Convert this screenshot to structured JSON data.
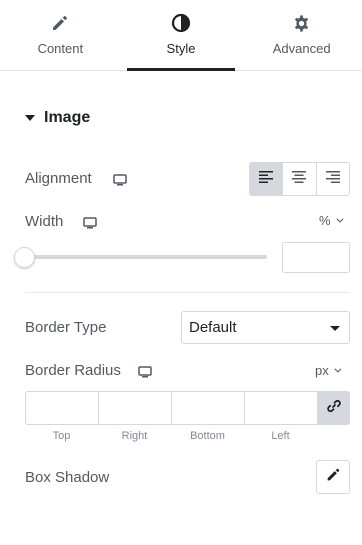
{
  "tabs": [
    {
      "label": "Content",
      "icon": "pencil-icon"
    },
    {
      "label": "Style",
      "icon": "half-circle-icon"
    },
    {
      "label": "Advanced",
      "icon": "gear-icon"
    }
  ],
  "active_tab": "Style",
  "section": {
    "title": "Image",
    "state": "expanded"
  },
  "alignment": {
    "label": "Alignment",
    "options": [
      "left",
      "center",
      "right"
    ],
    "selected": "left"
  },
  "width": {
    "label": "Width",
    "unit": "%",
    "value": "",
    "slider_value": 0
  },
  "border_type": {
    "label": "Border Type",
    "value": "Default"
  },
  "border_radius": {
    "label": "Border Radius",
    "unit": "px",
    "sides": [
      "Top",
      "Right",
      "Bottom",
      "Left"
    ],
    "values": [
      "",
      "",
      "",
      ""
    ]
  },
  "box_shadow": {
    "label": "Box Shadow"
  },
  "colors": {
    "text": "#515962",
    "heading": "#1f2124",
    "border": "#d5d8dc",
    "active_bg": "#d5d8dc"
  }
}
